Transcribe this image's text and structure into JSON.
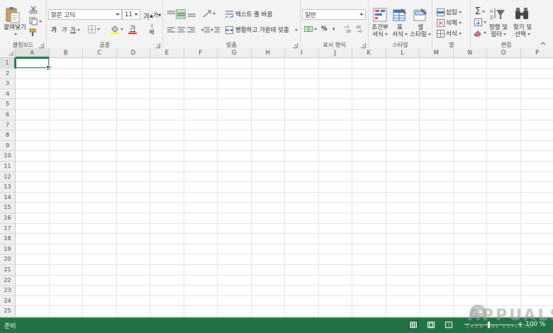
{
  "ribbon": {
    "clipboard": {
      "label": "클립보드",
      "paste": "붙여넣기"
    },
    "font": {
      "label": "글꼴",
      "font_name": "맑은 고딕",
      "font_size": "11",
      "grow": "가",
      "shrink": "가",
      "bold": "가",
      "italic": "가",
      "underline": "가",
      "font_color": "가",
      "phonetic": "배",
      "phonetic_sub": "ㅕ"
    },
    "alignment": {
      "label": "맞춤",
      "wrap_text": "텍스트 줄 바꿈",
      "merge_center": "병합하고 가운데 맞춤"
    },
    "number": {
      "label": "표시 형식",
      "format": "일반",
      "percent": "%",
      "comma": ","
    },
    "styles": {
      "label": "스타일",
      "conditional_l1": "조건부",
      "conditional_l2": "서식",
      "table_l1": "표",
      "table_l2": "서식",
      "cell_l1": "셀",
      "cell_l2": "스타일"
    },
    "cells": {
      "label": "셀",
      "insert": "삽입",
      "delete": "삭제",
      "format": "서식"
    },
    "editing": {
      "label": "편집",
      "sort_l1": "정렬 및",
      "sort_l2": "필터",
      "find_l1": "찾기 및",
      "find_l2": "선택"
    }
  },
  "sheet": {
    "columns": [
      "A",
      "B",
      "C",
      "D",
      "E",
      "F",
      "G",
      "H",
      "I",
      "J",
      "K",
      "L",
      "M",
      "N",
      "O",
      "P"
    ],
    "rows": [
      "1",
      "2",
      "3",
      "4",
      "5",
      "6",
      "7",
      "8",
      "9",
      "10",
      "11",
      "12",
      "13",
      "14",
      "15",
      "16",
      "17",
      "18",
      "19",
      "20",
      "21",
      "22",
      "23",
      "24",
      "25"
    ],
    "active_column": "A",
    "active_row": "1"
  },
  "status": {
    "ready": "준비",
    "zoom": "100 %"
  },
  "watermark": {
    "brand": "APPUALS",
    "tagline": "FROM THE EXPERTS!"
  },
  "colors": {
    "accent": "#217346",
    "font_color_bar": "#e02020",
    "highlight_bar": "#ffff00"
  }
}
